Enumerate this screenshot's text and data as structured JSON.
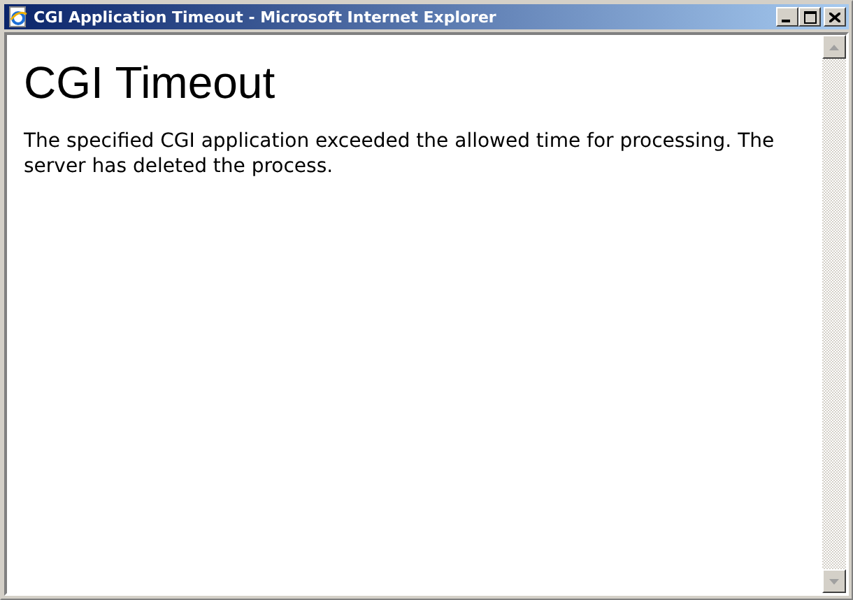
{
  "window": {
    "title": "CGI Application Timeout - Microsoft Internet Explorer"
  },
  "page": {
    "heading": "CGI Timeout",
    "message": "The specified CGI application exceeded the allowed time for processing. The server has deleted the process."
  }
}
